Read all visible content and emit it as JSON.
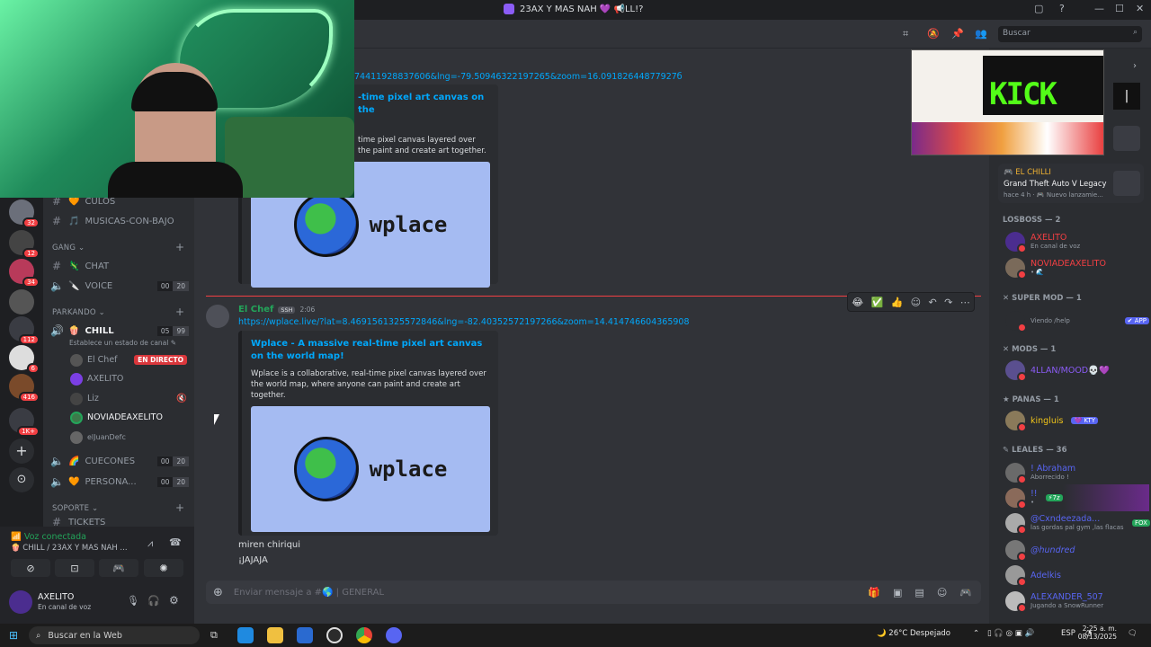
{
  "window": {
    "title": "23AX Y MAS NAH 💜 📢LL!?"
  },
  "rail": {
    "badges": [
      "32",
      "12",
      "34",
      "112",
      "6",
      "416",
      "1K+"
    ]
  },
  "sidebar": {
    "channels_top": [
      {
        "emoji": "🧡",
        "name": "CULOS"
      },
      {
        "emoji": "🎵",
        "name": "MUSICAS-CON-BAJO"
      }
    ],
    "category_gang": "GANG",
    "gang_channels": [
      {
        "emoji": "🦎",
        "name": "CHAT",
        "type": "text"
      },
      {
        "emoji": "🔪",
        "name": "VOICE",
        "type": "voice",
        "count": "00",
        "limit": "20"
      }
    ],
    "category_parkando": "PARKANDO",
    "chill": {
      "emoji": "🍿",
      "name": "CHILL",
      "count": "05",
      "limit": "99",
      "status": "Establece un estado de canal"
    },
    "voice_users": [
      {
        "name": "El Chef",
        "live": "EN DIRECTO"
      },
      {
        "name": "AXELITO"
      },
      {
        "name": "Liz"
      },
      {
        "name": "NOVIADEAXELITO"
      },
      {
        "name": "elJuanDefc"
      }
    ],
    "more_channels": [
      {
        "emoji": "🌈",
        "name": "CUECONES",
        "count": "00",
        "limit": "20"
      },
      {
        "emoji": "🧡",
        "name": "PERSONA...",
        "count": "00",
        "limit": "20"
      }
    ],
    "category_soporte": "SOPORTE",
    "partial_channel": "TICKETS"
  },
  "voicebar": {
    "status": "Voz conectada",
    "channel": "CHILL / 23AX Y MAS NAH ..."
  },
  "userbar": {
    "username": "AXELITO",
    "status": "En canal de voz"
  },
  "search": {
    "placeholder": "Buscar"
  },
  "messages": {
    "link_partial": "74411928837606&lng=-79.50946322197265&zoom=16.09182644877927б",
    "embed1_title_partial": "-time pixel art canvas on the",
    "embed1_desc_partial": "time pixel canvas layered over the paint and create art together.",
    "author": "El Chef",
    "author_tag": "SSH",
    "time": "2:06",
    "link": "https://wplace.live/?lat=8.4691561325572846&lng=-82.40352572197266&zoom=14.414746604365908",
    "embed2_title": "Wplace - A massive real-time pixel art canvas on the world map!",
    "embed2_desc": "Wplace is a collaborative, real-time pixel canvas layered over the world map, where anyone can paint and create art together.",
    "image_text": "wplace",
    "line1": "miren chiriqui",
    "line2": "¡JAJAJA"
  },
  "input": {
    "placeholder": "Enviar mensaje a #🌎 | GENERAL"
  },
  "reactions": [
    "😂",
    "✅",
    "👍"
  ],
  "activity": {
    "user": "EL CHILLI",
    "game": "Grand Theft Auto V Legacy",
    "meta": "hace 4 h · 🎮 Nuevo lanzamie..."
  },
  "members": {
    "groups": [
      {
        "title": "LOSBOSS — 2",
        "items": [
          {
            "name": "AXELITO",
            "sub": "En canal de voz",
            "color": "#f23f43"
          },
          {
            "name": "NOVIADEAXELITO",
            "sub": "• 🌊",
            "color": "#f23f43"
          }
        ]
      },
      {
        "title": "SUPER MOD — 1",
        "items": [
          {
            "name": "",
            "sub": "Viendo /help",
            "color": "#dbdee1",
            "tag": "✔ APP"
          }
        ]
      },
      {
        "title": "MODS — 1",
        "items": [
          {
            "name": "4LLAN/MOOD💀💜",
            "sub": "",
            "color": "#8b5cf6"
          }
        ]
      },
      {
        "title": "PANAS — 1",
        "items": [
          {
            "name": "kingluis",
            "sub": "",
            "color": "#f0c419",
            "tag": "💜 KTY"
          }
        ]
      },
      {
        "title": "LEALES — 36",
        "items": [
          {
            "name": "! Abraham",
            "sub": "Aborrecido !",
            "color": "#5865f2"
          },
          {
            "name": "!!",
            "sub": "•",
            "color": "#5865f2",
            "tag": "⚡7z"
          },
          {
            "name": "@Cxndeezada...",
            "sub": "las gordas pal gym ,las flacas ...",
            "color": "#5865f2",
            "tag": "FOX"
          },
          {
            "name": "@hundred",
            "sub": "",
            "color": "#5865f2"
          },
          {
            "name": "Adelkis",
            "sub": "",
            "color": "#5865f2"
          },
          {
            "name": "ALEXANDER_507",
            "sub": "Jugando a SnowRunner",
            "color": "#5865f2"
          }
        ]
      }
    ]
  },
  "taskbar": {
    "search": "Buscar en la Web",
    "weather": "26°C Despejado",
    "lang": "ESP",
    "time": "2:25 a. m.",
    "date": "08/13/2025"
  },
  "preview": {
    "text": "KICK"
  }
}
